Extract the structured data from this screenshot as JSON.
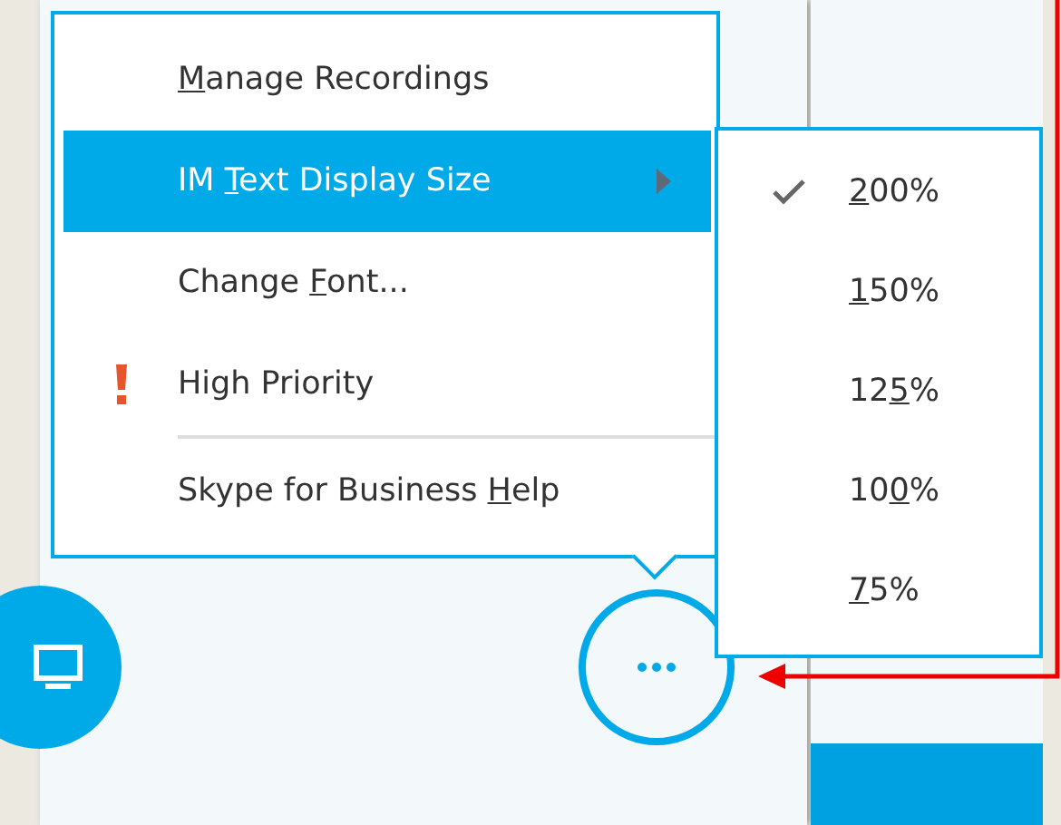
{
  "menu": {
    "items": [
      {
        "kind": "item",
        "label": {
          "key": "M",
          "post": "anage Recordings"
        },
        "selected": false,
        "has_submenu": false
      },
      {
        "kind": "item",
        "label": {
          "pre": "IM ",
          "key": "T",
          "post": "ext Display Size"
        },
        "selected": true,
        "has_submenu": true
      },
      {
        "kind": "item",
        "label": {
          "pre": "Change ",
          "key": "F",
          "post": "ont..."
        },
        "selected": false,
        "has_submenu": false
      },
      {
        "kind": "priority",
        "label": {
          "pre": "High Priority"
        },
        "selected": false,
        "has_submenu": false
      },
      {
        "kind": "separator"
      },
      {
        "kind": "item",
        "label": {
          "pre": "Skype for Business ",
          "key": "H",
          "post": "elp"
        },
        "selected": false,
        "has_submenu": false
      }
    ]
  },
  "submenu": {
    "items": [
      {
        "label": {
          "key": "2",
          "post": "00%"
        },
        "checked": true
      },
      {
        "label": {
          "key": "1",
          "post": "50%"
        },
        "checked": false
      },
      {
        "label": {
          "pre": "12",
          "key": "5",
          "post": "%"
        },
        "checked": false
      },
      {
        "label": {
          "pre": "10",
          "key": "0",
          "post": "%"
        },
        "checked": false
      },
      {
        "label": {
          "key": "7",
          "post": "5%"
        },
        "checked": false
      }
    ]
  }
}
